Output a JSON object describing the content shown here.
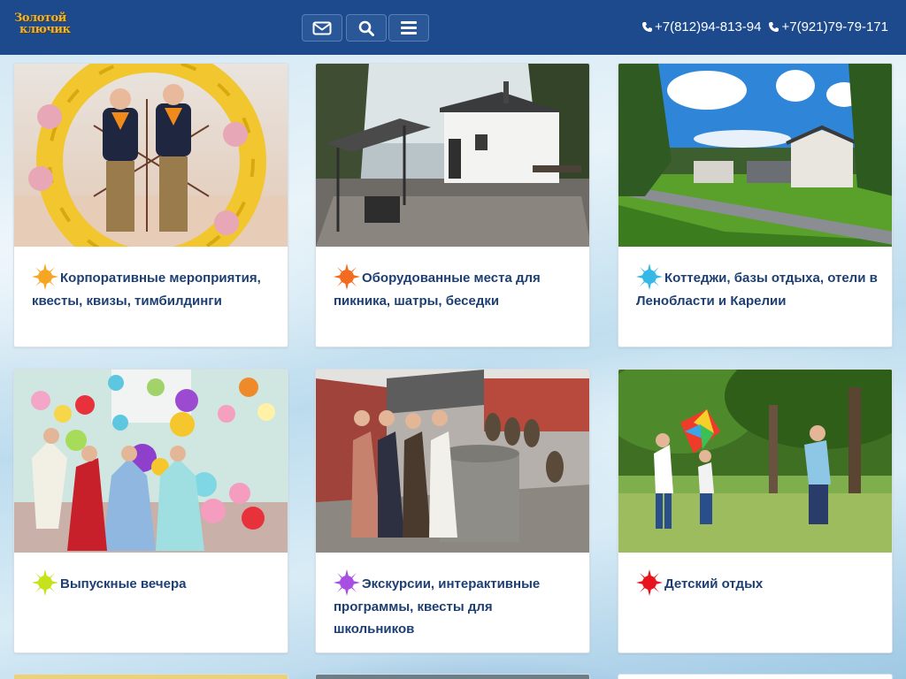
{
  "header": {
    "logo_text_line1": "Золотой",
    "logo_text_line2": "ключик",
    "buttons": [
      {
        "icon": "envelope-icon"
      },
      {
        "icon": "search-icon"
      },
      {
        "icon": "menu-icon"
      }
    ],
    "phones": [
      "+7(812)94-813-94",
      "+7(921)79-79-171"
    ]
  },
  "cards": [
    {
      "title": "Корпоративные мероприятия, квесты, квизы, тимбилдинги",
      "sun_color": "#f5a623"
    },
    {
      "title": "Оборудованные места для пикника, шатры, беседки",
      "sun_color": "#f26b21"
    },
    {
      "title": "Коттеджи, базы отдыха, отели в Ленобласти и Карелии",
      "sun_color": "#35b8e6"
    },
    {
      "title": "Выпускные вечера",
      "sun_color": "#c6e21a"
    },
    {
      "title": "Экскурсии, интерактивные программы, квесты для школьников",
      "sun_color": "#a64fe0"
    },
    {
      "title": "Детский отдых",
      "sun_color": "#e8121d"
    }
  ],
  "colors": {
    "header_bg": "#1d4a8c",
    "title_text": "#1d3f73"
  }
}
